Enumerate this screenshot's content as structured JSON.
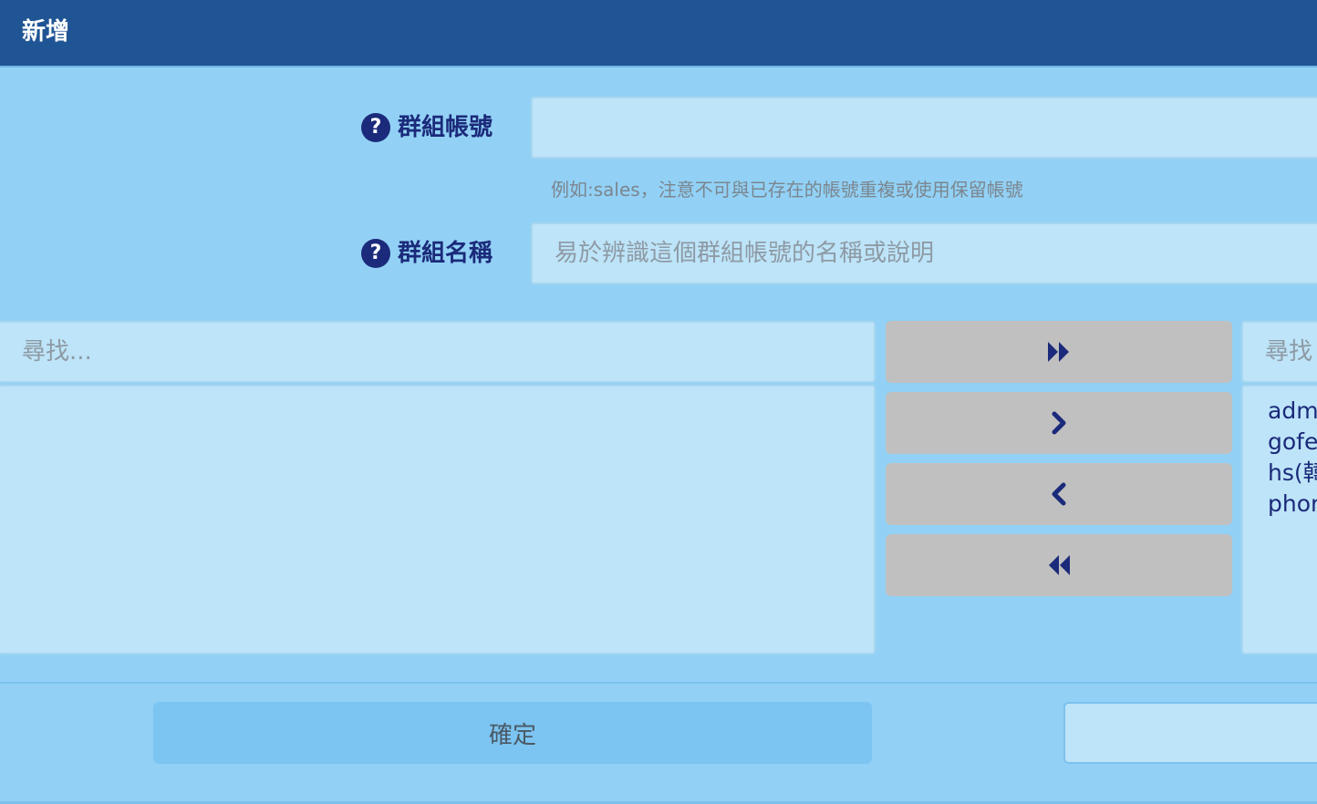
{
  "dialog": {
    "title": "新增"
  },
  "form": {
    "group_account": {
      "label": "群組帳號",
      "value": "",
      "hint": "例如:sales，注意不可與已存在的帳號重複或使用保留帳號",
      "icon": "help-circle-icon"
    },
    "group_name": {
      "label": "群組名稱",
      "placeholder": "易於辨識這個群組帳號的名稱或說明",
      "icon": "help-circle-icon"
    }
  },
  "member_picker": {
    "left": {
      "search_placeholder": "尋找...",
      "items": []
    },
    "right": {
      "search_placeholder": "尋找",
      "items": [
        "adm",
        "gofe",
        "hs(韓",
        "phor"
      ]
    },
    "buttons": {
      "move_all_right_icon": "double-chevron-right-icon",
      "move_right_icon": "chevron-right-icon",
      "move_left_icon": "chevron-left-icon",
      "move_all_left_icon": "double-chevron-left-icon"
    }
  },
  "footer": {
    "confirm_label": "確定",
    "cancel_label": ""
  },
  "colors": {
    "header_bg": "#205595",
    "body_bg": "#92d1f5",
    "field_bg": "#bde4f8",
    "label_color": "#1b2a7a",
    "button_gray": "#c0c0c0",
    "confirm_bg": "#7cc4f1"
  }
}
